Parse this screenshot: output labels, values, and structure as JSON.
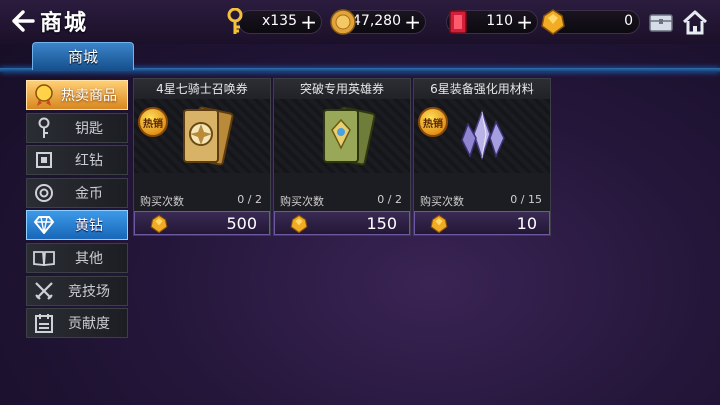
{
  "header": {
    "back_icon": "left-arrow-icon",
    "title": "商城"
  },
  "resources": {
    "keys": {
      "icon": "key-icon",
      "value": "x135",
      "plus": "+"
    },
    "gold": {
      "icon": "gold-coin-icon",
      "value": "47,280",
      "plus": "+"
    },
    "red_diamond": {
      "icon": "red-gem-icon",
      "value": "110",
      "plus": "+"
    },
    "yellow_diamond": {
      "icon": "yellow-gem-icon",
      "value": "0"
    }
  },
  "top_buttons": [
    "chest-icon",
    "home-icon"
  ],
  "tab": {
    "label": "商城"
  },
  "sidebar": {
    "items": [
      {
        "label": "热卖商品",
        "icon": "medal-icon",
        "state": "selected-orange"
      },
      {
        "label": "钥匙",
        "icon": "key-icon",
        "state": "normal"
      },
      {
        "label": "红钻",
        "icon": "red-gem-icon",
        "state": "normal"
      },
      {
        "label": "金币",
        "icon": "coin-icon",
        "state": "normal"
      },
      {
        "label": "黄钻",
        "icon": "diamond-icon",
        "state": "selected-blue"
      },
      {
        "label": "其他",
        "icon": "book-icon",
        "state": "normal"
      },
      {
        "label": "竞技场",
        "icon": "crossed-swords-icon",
        "state": "normal"
      },
      {
        "label": "贡献度",
        "icon": "calendar-icon",
        "state": "normal"
      }
    ]
  },
  "products": [
    {
      "name": "4星七骑士召唤券",
      "badge": "热销",
      "image": "summon-ticket-icon",
      "purchase_label": "购买次数",
      "purchase_count": "0 / 2",
      "price": "500",
      "price_icon": "yellow-gem-icon"
    },
    {
      "name": "突破专用英雄券",
      "badge": "",
      "image": "hero-ticket-icon",
      "purchase_label": "购买次数",
      "purchase_count": "0 / 2",
      "price": "150",
      "price_icon": "yellow-gem-icon"
    },
    {
      "name": "6星装备强化用材料",
      "badge": "热销",
      "image": "crystal-icon",
      "purchase_label": "购买次数",
      "purchase_count": "0 / 15",
      "price": "10",
      "price_icon": "yellow-gem-icon"
    }
  ],
  "colors": {
    "tab_blue": "#2f6fb3",
    "selected_orange": "#e8a23a",
    "selected_blue": "#2a82d6",
    "price_bar": "#3a2a55"
  }
}
